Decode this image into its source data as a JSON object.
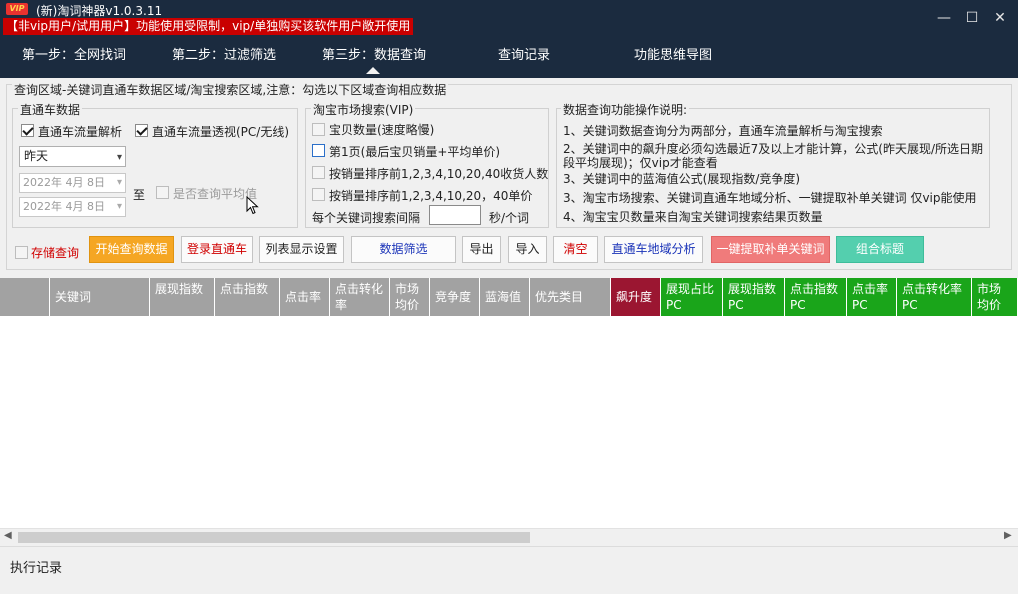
{
  "app": {
    "logo": "VIP",
    "title": "(新)淘词神器v1.0.3.11",
    "warning": "【非vip用户/试用用户】功能使用受限制，vip/单独购买该软件用户敞开使用"
  },
  "window": {
    "min": "—",
    "max": "☐",
    "close": "✕"
  },
  "nav": {
    "items": [
      "第一步：全网找词",
      "第二步：过滤筛选",
      "第三步：数据查询",
      "查询记录",
      "功能思维导图"
    ],
    "active_index": 2
  },
  "main": {
    "legend": "查询区域-关键词直通车数据区域/淘宝搜索区域,注意：勾选以下区域查询相应数据"
  },
  "ztc": {
    "legend": "直通车数据",
    "cb_flow_analysis": "直通车流量解析",
    "cb_flow_perspective": "直通车流量透视(PC/无线)",
    "period_select": "昨天",
    "date_from": "2022年 4月 8日",
    "date_to": "2022年 4月 8日",
    "to_label": "至",
    "cb_avg": "是否查询平均值"
  },
  "taobao": {
    "legend": "淘宝市场搜索(VIP)",
    "opt1": "宝贝数量(速度略慢)",
    "opt2": "第1页(最后宝贝销量+平均单价)",
    "opt3": "按销量排序前1,2,3,4,10,20,40收货人数",
    "opt4": "按销量排序前1,2,3,4,10,20，40单价",
    "interval_label": "每个关键词搜索间隔",
    "interval_unit": "秒/个词",
    "interval_value": ""
  },
  "info": {
    "legend": "数据查询功能操作说明:",
    "lines": [
      "1、关键词数据查询分为两部分，直通车流量解析与淘宝搜索",
      "2、关键词中的飙升度必须勾选最近7及以上才能计算，公式(昨天展现/所选日期段平均展现)；仅vip才能查看",
      "3、关键词中的蓝海值公式(展现指数/竞争度)",
      "3、淘宝市场搜索、关键词直通车地域分析、一键提取补单关键词 仅vip能使用",
      "4、淘宝宝贝数量来自淘宝关键词搜索结果页数量"
    ]
  },
  "actions": {
    "save_query": "存储查询",
    "start": "开始查询数据",
    "login": "登录直通车",
    "columns": "列表显示设置",
    "filter": "数据筛选",
    "export": "导出",
    "import": "导入",
    "clear": "清空",
    "region": "直通车地域分析",
    "extract": "一键提取补单关键词",
    "combine": "组合标题"
  },
  "table": {
    "headers": [
      "",
      "关键词",
      "展现指数",
      "点击指数",
      "点击率",
      "点击转化率",
      "市场均价",
      "竞争度",
      "蓝海值",
      "优先类目",
      "飙升度",
      "展现占比PC",
      "展现指数PC",
      "点击指数PC",
      "点击率PC",
      "点击转化率PC",
      "市场均价PC"
    ]
  },
  "footer": {
    "log_label": "执行记录"
  }
}
